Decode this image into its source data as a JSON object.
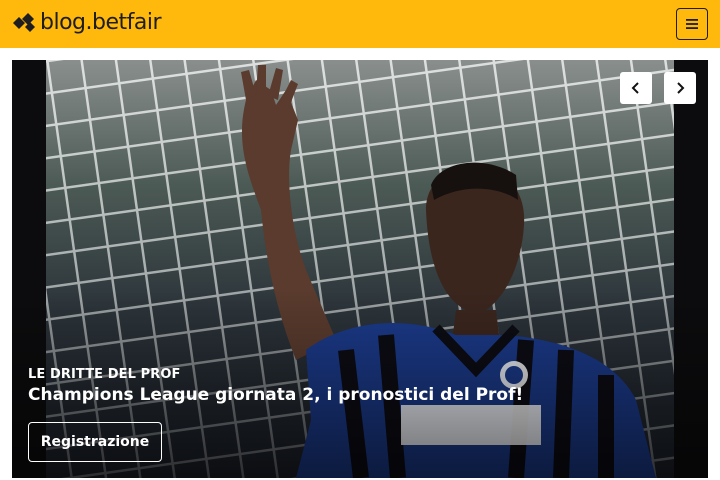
{
  "header": {
    "logo_text": "blog.betfair",
    "logo_icon": "betfair-arrows-icon",
    "menu_icon": "hamburger-menu-icon"
  },
  "hero": {
    "kicker": "LE DRITTE DEL PROF",
    "headline": "Champions League giornata 2, i pronostici del Prof!",
    "cta_label": "Registrazione",
    "prev_icon": "chevron-left-icon",
    "next_icon": "chevron-right-icon"
  },
  "colors": {
    "brand_yellow": "#ffb80c",
    "text_dark": "#1e1e1e",
    "overlay_text": "#ffffff"
  }
}
